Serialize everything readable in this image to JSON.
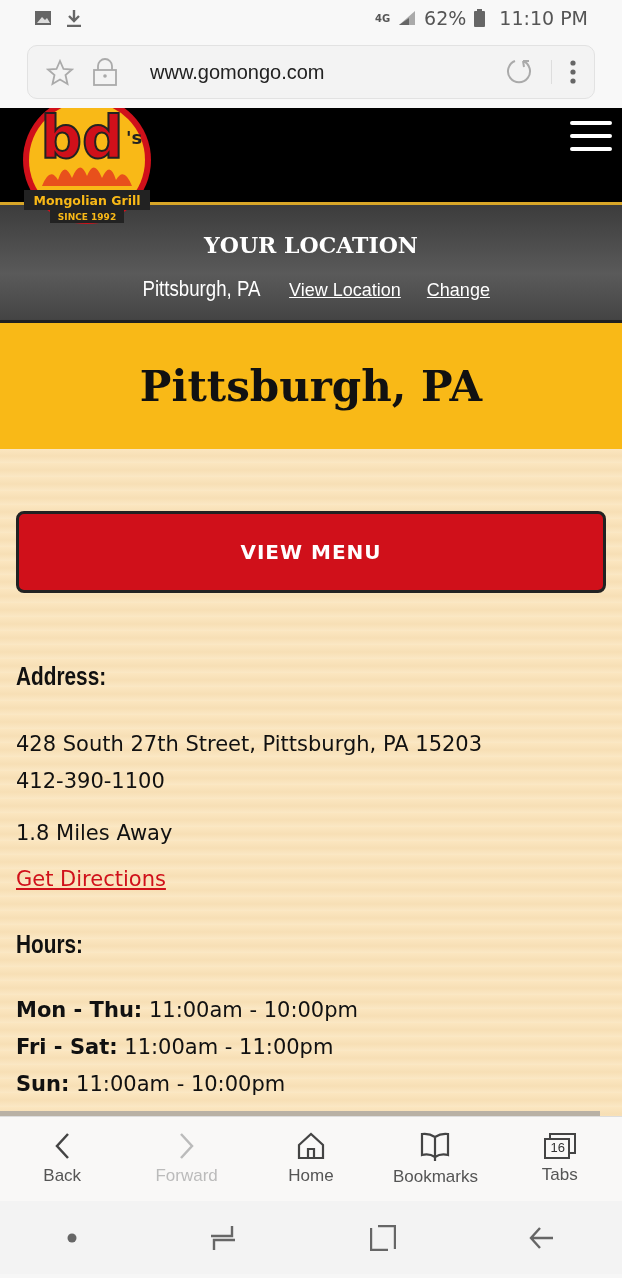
{
  "status_bar": {
    "network": "4G",
    "battery": "62%",
    "time": "11:10 PM"
  },
  "address_bar": {
    "url": "www.gomongo.com"
  },
  "header": {
    "logo": {
      "mark": "bd's",
      "name": "Mongolian Grill",
      "since": "SINCE 1992"
    }
  },
  "location_bar": {
    "title": "YOUR LOCATION",
    "city": "Pittsburgh, PA",
    "links": [
      "View Location",
      "Change"
    ]
  },
  "page_title": "Pittsburgh, PA",
  "menu_button": "VIEW MENU",
  "address": {
    "heading": "Address:",
    "street": "428 South 27th Street, Pittsburgh, PA 15203",
    "phone": "412-390-1100",
    "distance": "1.8 Miles Away",
    "directions": "Get Directions"
  },
  "hours": {
    "heading": "Hours:",
    "rows": [
      {
        "text": "**Mon - Thu:** 11:00am - 10:00pm"
      },
      {
        "text": "**Fri - Sat:** 11:00am - 11:00pm"
      },
      {
        "text": "**Sun:** 11:00am - 10:00pm"
      }
    ]
  },
  "browser_toolbar": [
    {
      "kind": "back",
      "label": "Back",
      "disabled": false
    },
    {
      "kind": "forward",
      "label": "Forward",
      "disabled": true
    },
    {
      "kind": "home",
      "label": "Home",
      "disabled": false
    },
    {
      "kind": "bookmarks",
      "label": "Bookmarks",
      "disabled": false
    },
    {
      "kind": "tabs",
      "label": "Tabs",
      "count": "16",
      "disabled": false
    }
  ]
}
